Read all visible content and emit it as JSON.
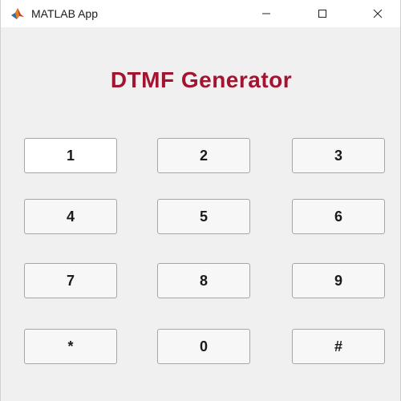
{
  "window": {
    "title": "MATLAB App"
  },
  "app": {
    "heading": "DTMF Generator"
  },
  "keypad": {
    "keys": [
      "1",
      "2",
      "3",
      "4",
      "5",
      "6",
      "7",
      "8",
      "9",
      "*",
      "0",
      "#"
    ]
  },
  "colors": {
    "heading": "#a2142f",
    "background": "#f0f0f0",
    "button_border": "#a6a6a6"
  },
  "icons": {
    "app": "matlab-logo-icon",
    "minimize": "minimize-icon",
    "maximize": "maximize-icon",
    "close": "close-icon"
  }
}
